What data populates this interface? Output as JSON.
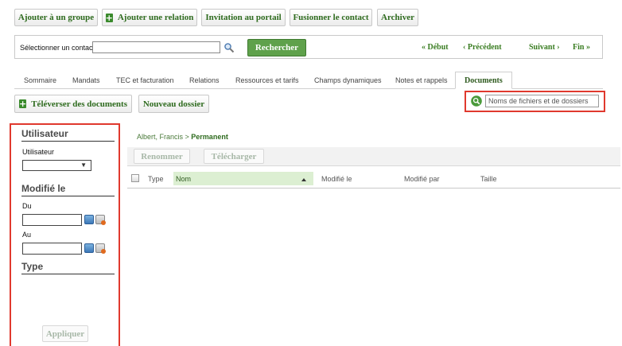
{
  "toolbar": {
    "add_group": "Ajouter à un groupe",
    "add_relation": "Ajouter une relation",
    "portal_invite": "Invitation au portail",
    "merge_contact": "Fusionner le contact",
    "archive": "Archiver"
  },
  "contact_search": {
    "label": "Sélectionner un contact",
    "value": "",
    "search_button": "Rechercher",
    "nav_first": "« Début",
    "nav_prev": "‹ Précédent",
    "nav_next": "Suivant ›",
    "nav_last": "Fin »"
  },
  "tabs": [
    {
      "label": "Sommaire"
    },
    {
      "label": "Mandats"
    },
    {
      "label": "TEC et facturation"
    },
    {
      "label": "Relations"
    },
    {
      "label": "Ressources et tarifs"
    },
    {
      "label": "Champs dynamiques"
    },
    {
      "label": "Notes et rappels"
    },
    {
      "label": "Documents",
      "active": true
    }
  ],
  "actions": {
    "upload": "Téléverser des documents",
    "new_folder": "Nouveau dossier"
  },
  "file_search": {
    "placeholder": "Noms de fichiers et de dossiers"
  },
  "filters": {
    "user_section": "Utilisateur",
    "user_label": "Utilisateur",
    "user_value": "",
    "modified_section": "Modifié le",
    "from_label": "Du",
    "to_label": "Au",
    "type_section": "Type",
    "apply": "Appliquer"
  },
  "breadcrumb": {
    "parent": "Albert, Francis",
    "separator": " > ",
    "current": "Permanent"
  },
  "file_actions": {
    "rename": "Renommer",
    "download": "Télécharger"
  },
  "table": {
    "columns": [
      "Type",
      "Nom",
      "Modifié le",
      "Modifié par",
      "Taille"
    ]
  },
  "colors": {
    "accent_green": "#3a7d22",
    "highlight_red": "#e0392e",
    "sorted_column": "#dcefd2"
  }
}
